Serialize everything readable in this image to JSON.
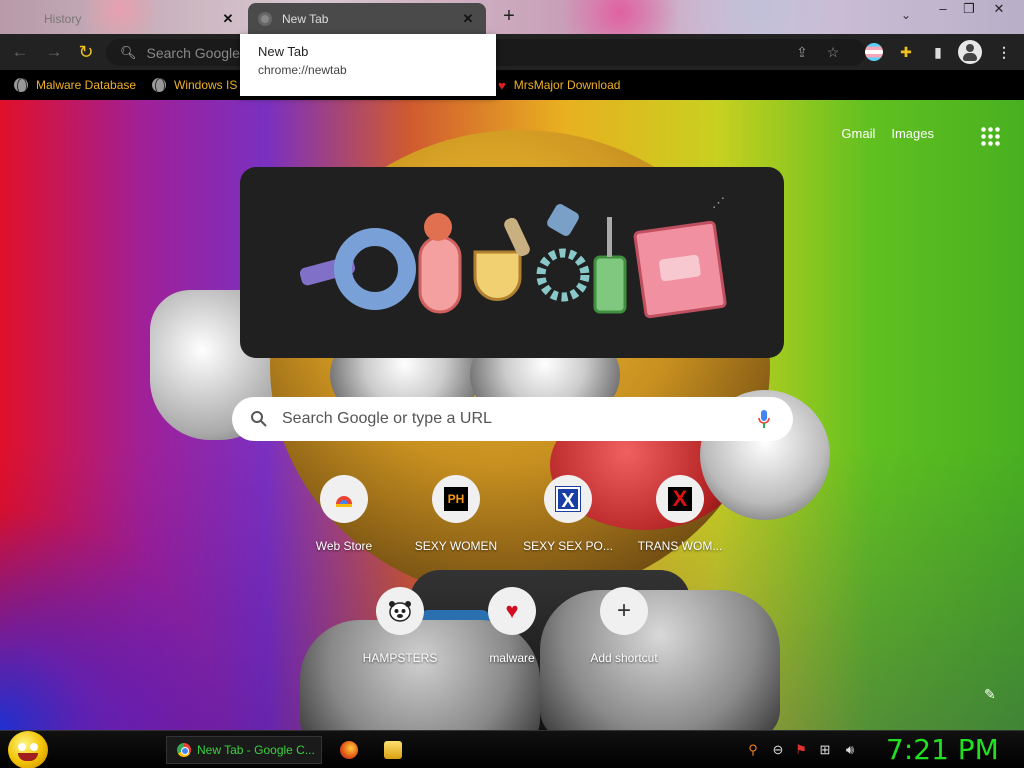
{
  "tabs": [
    {
      "label": "History",
      "icon": "history-icon"
    },
    {
      "label": "New Tab",
      "icon": "chrome-favicon-icon"
    }
  ],
  "tooltip": {
    "title": "New Tab",
    "url": "chrome://newtab"
  },
  "omnibox": {
    "placeholder": "Search Google or type a URL",
    "visible_text": "Search Google c"
  },
  "bookmarks": [
    {
      "label": "Malware Database",
      "icon": "globe-icon"
    },
    {
      "label": "Windows IS",
      "icon": "globe-icon"
    },
    {
      "label": "MrsMajor Download",
      "icon": "heart-icon"
    }
  ],
  "ntp": {
    "links": {
      "gmail": "Gmail",
      "images": "Images"
    },
    "search_placeholder": "Search Google or type a URL",
    "shortcuts": [
      {
        "name": "Web Store",
        "icon": "web-store-icon"
      },
      {
        "name": "SEXY WOMEN",
        "icon": "ph-logo-icon"
      },
      {
        "name": "SEXY SEX PO...",
        "icon": "x-blue-icon"
      },
      {
        "name": "TRANS WOM...",
        "icon": "x-red-icon"
      },
      {
        "name": "HAMPSTERS",
        "icon": "hamster-icon"
      },
      {
        "name": "malware",
        "icon": "heart-icon"
      },
      {
        "name": "Add shortcut",
        "icon": "plus-icon"
      }
    ]
  },
  "taskbar": {
    "active_window": "New Tab - Google C...",
    "clock": "7:21 PM"
  },
  "colors": {
    "bookmark_text": "#f0b028",
    "reload_icon": "#f0c020",
    "taskbar_text": "#3cd040",
    "clock": "#20e020"
  }
}
